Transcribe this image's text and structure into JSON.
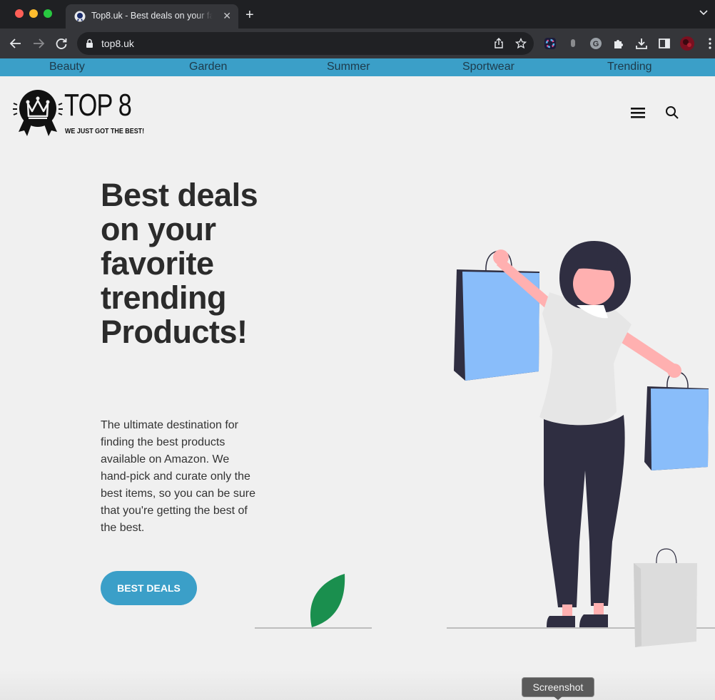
{
  "browser": {
    "tab_title": "Top8.uk - Best deals on your favorite trending Products!",
    "tab_close": "✕",
    "new_tab": "+",
    "url": "top8.uk"
  },
  "categories": [
    "Beauty",
    "Garden",
    "Summer",
    "Sportwear",
    "Trending"
  ],
  "header": {
    "logo_title": "TOP 8",
    "logo_tagline": "WE JUST GOT THE BEST!"
  },
  "hero": {
    "title": "Best deals on your favorite trending Products!",
    "description": "The ultimate destination for finding the best products available on Amazon. We hand-pick and curate only the best items, so you can be sure that you're getting the best of the best.",
    "cta_label": "BEST DEALS"
  },
  "tooltip": "Screenshot",
  "colors": {
    "accent": "#3b9fc8",
    "bag_blue": "#89bdfa",
    "dark": "#2f2e41",
    "skin": "#ffb0b0",
    "leaf": "#1a8f4e"
  }
}
